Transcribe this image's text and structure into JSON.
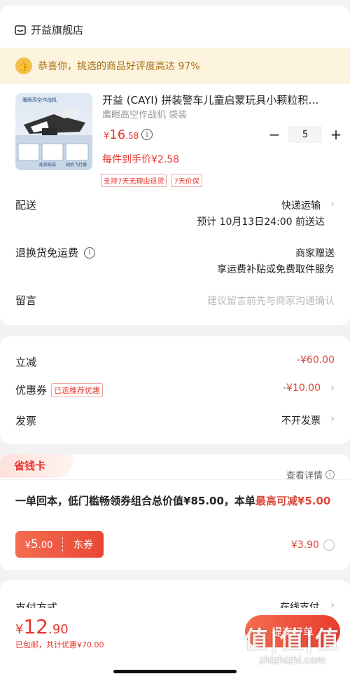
{
  "store": {
    "name": "开益旗舰店",
    "icon": "store-icon"
  },
  "banner": {
    "text": "恭喜你，挑选的商品好评度高达 97%",
    "icon": "thumb-up-icon"
  },
  "product": {
    "title": "开益 (CAYI) 拼装警车儿童启蒙玩具小颗粒积…",
    "spec": "鹰眼高空作战机 袋装",
    "price_symbol": "¥",
    "price_int": "16",
    "price_dec": ".58",
    "quantity": "5",
    "minus": "−",
    "plus": "+",
    "unit_price": "每件到手价¥2.58",
    "tags": [
      "支持7天无理由退货",
      "7天价保"
    ],
    "thumb_caption": "鹰眼高空作战机",
    "thumb_sub1": "能拆能装",
    "thumb_sub2": "战机飞行器"
  },
  "delivery": {
    "label": "配送",
    "method": "快递运输",
    "eta": "预计 10月13日24:00 前送达"
  },
  "return_fee": {
    "label": "退换货免运费",
    "value": "商家赠送",
    "sub": "享运费补贴或免费取件服务"
  },
  "message": {
    "label": "留言",
    "placeholder": "建议留言前先与商家沟通确认"
  },
  "discounts": {
    "instant_label": "立减",
    "instant_value": "-¥60.00",
    "coupon_label": "优惠券",
    "coupon_badge": "已选推荐优惠",
    "coupon_value": "-¥10.00",
    "invoice_label": "发票",
    "invoice_value": "不开发票"
  },
  "saver": {
    "title": "省钱卡",
    "detail": "查看详情",
    "desc_prefix": "一单回本，低门槛畅领券组合总价值¥85.00，本单",
    "desc_highlight": "最高可减¥5.00",
    "coupon_sym": "¥",
    "coupon_amount": "5",
    "coupon_dec": ".00",
    "coupon_name": "东券",
    "price": "¥3.90"
  },
  "payment": {
    "label": "支付方式",
    "value": "在线支付"
  },
  "footer": {
    "total_sym": "¥",
    "total_int": "12",
    "total_dec": ".90",
    "note": "已包邮，共计优惠¥70.00",
    "submit": "提交订单",
    "watermark_big": "值|值|值",
    "watermark_small": "zhizhizhi.com"
  },
  "colors": {
    "accent": "#e8362f",
    "banner_bg": "#fdf4df",
    "banner_text": "#a87114"
  }
}
